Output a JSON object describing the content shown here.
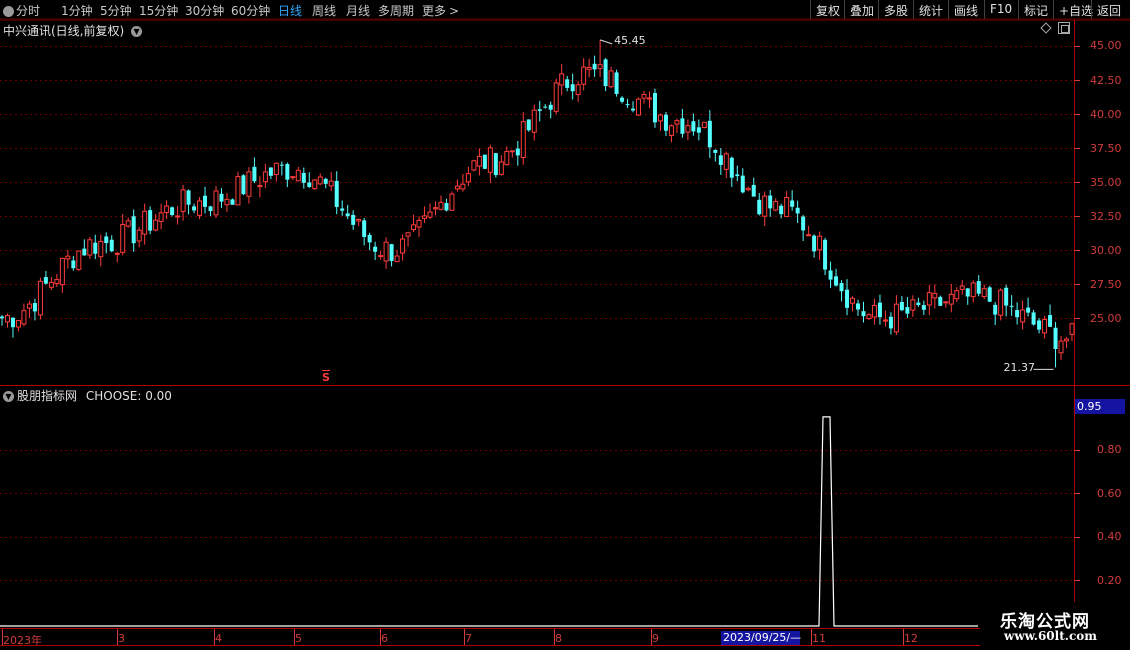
{
  "toolbar": {
    "periods": [
      "分时",
      "1分钟",
      "5分钟",
      "15分钟",
      "30分钟",
      "60分钟",
      "日线",
      "周线",
      "月线",
      "多周期",
      "更多"
    ],
    "active_period": "日线",
    "more_chevron": ">",
    "buttons": [
      "复权",
      "叠加",
      "多股",
      "统计",
      "画线",
      "F10",
      "标记",
      "+自选",
      "返回"
    ]
  },
  "main_chart": {
    "title": "中兴通讯(日线,前复权)",
    "y_ticks": [
      "45.00",
      "42.50",
      "40.00",
      "37.50",
      "35.00",
      "32.50",
      "30.00",
      "27.50",
      "25.00"
    ],
    "high_label": "45.45",
    "low_label": "21.37",
    "marker_label": "S"
  },
  "indicator": {
    "title": "股朋指标网",
    "formula_label": "CHOOSE: 0.00",
    "current_value": "0.95",
    "y_ticks": [
      "0.80",
      "0.60",
      "0.40",
      "0.20"
    ]
  },
  "date_axis": {
    "ticks": [
      "2023年",
      "3",
      "4",
      "5",
      "6",
      "7",
      "8",
      "9",
      "11",
      "12"
    ],
    "cursor_label": "2023/09/25/—"
  },
  "watermark": {
    "name": "乐淘公式网",
    "url": "www.60lt.com"
  },
  "colors": {
    "up": "#ff3c3c",
    "down": "#54ffff",
    "grid": "#6e0000",
    "axis": "#d23c3c",
    "active_period": "#2ea6ff",
    "indicator_line": "#ffffff",
    "current_value_bg": "#1414a0"
  },
  "chart_data": [
    {
      "type": "candlestick",
      "title": "中兴通讯(日线,前复权)",
      "ylim": [
        21.0,
        46.5
      ],
      "yticks": [
        25.0,
        27.5,
        30.0,
        32.5,
        35.0,
        37.5,
        40.0,
        42.5,
        45.0
      ],
      "high": 45.45,
      "low": 21.37,
      "monthly_path": [
        {
          "month": "2023-01",
          "close": 25.0
        },
        {
          "month": "2023-02",
          "close": 30.5
        },
        {
          "month": "2023-03",
          "close": 33.5
        },
        {
          "month": "2023-04",
          "close": 36.0
        },
        {
          "month": "2023-05",
          "close": 30.0
        },
        {
          "month": "2023-06",
          "close": 36.5
        },
        {
          "month": "2023-07",
          "close": 43.0
        },
        {
          "month": "2023-08",
          "close": 39.5
        },
        {
          "month": "2023-09",
          "close": 33.0
        },
        {
          "month": "2023-10",
          "close": 25.0
        },
        {
          "month": "2023-11",
          "close": 26.5
        },
        {
          "month": "2023-12",
          "close": 23.5
        }
      ]
    },
    {
      "type": "line",
      "title": "CHOOSE",
      "ylim": [
        0,
        1.0
      ],
      "yticks": [
        0.2,
        0.4,
        0.6,
        0.8
      ],
      "current_value": 0.95,
      "spike_date": "2023-10",
      "spike_value": 0.95
    }
  ]
}
